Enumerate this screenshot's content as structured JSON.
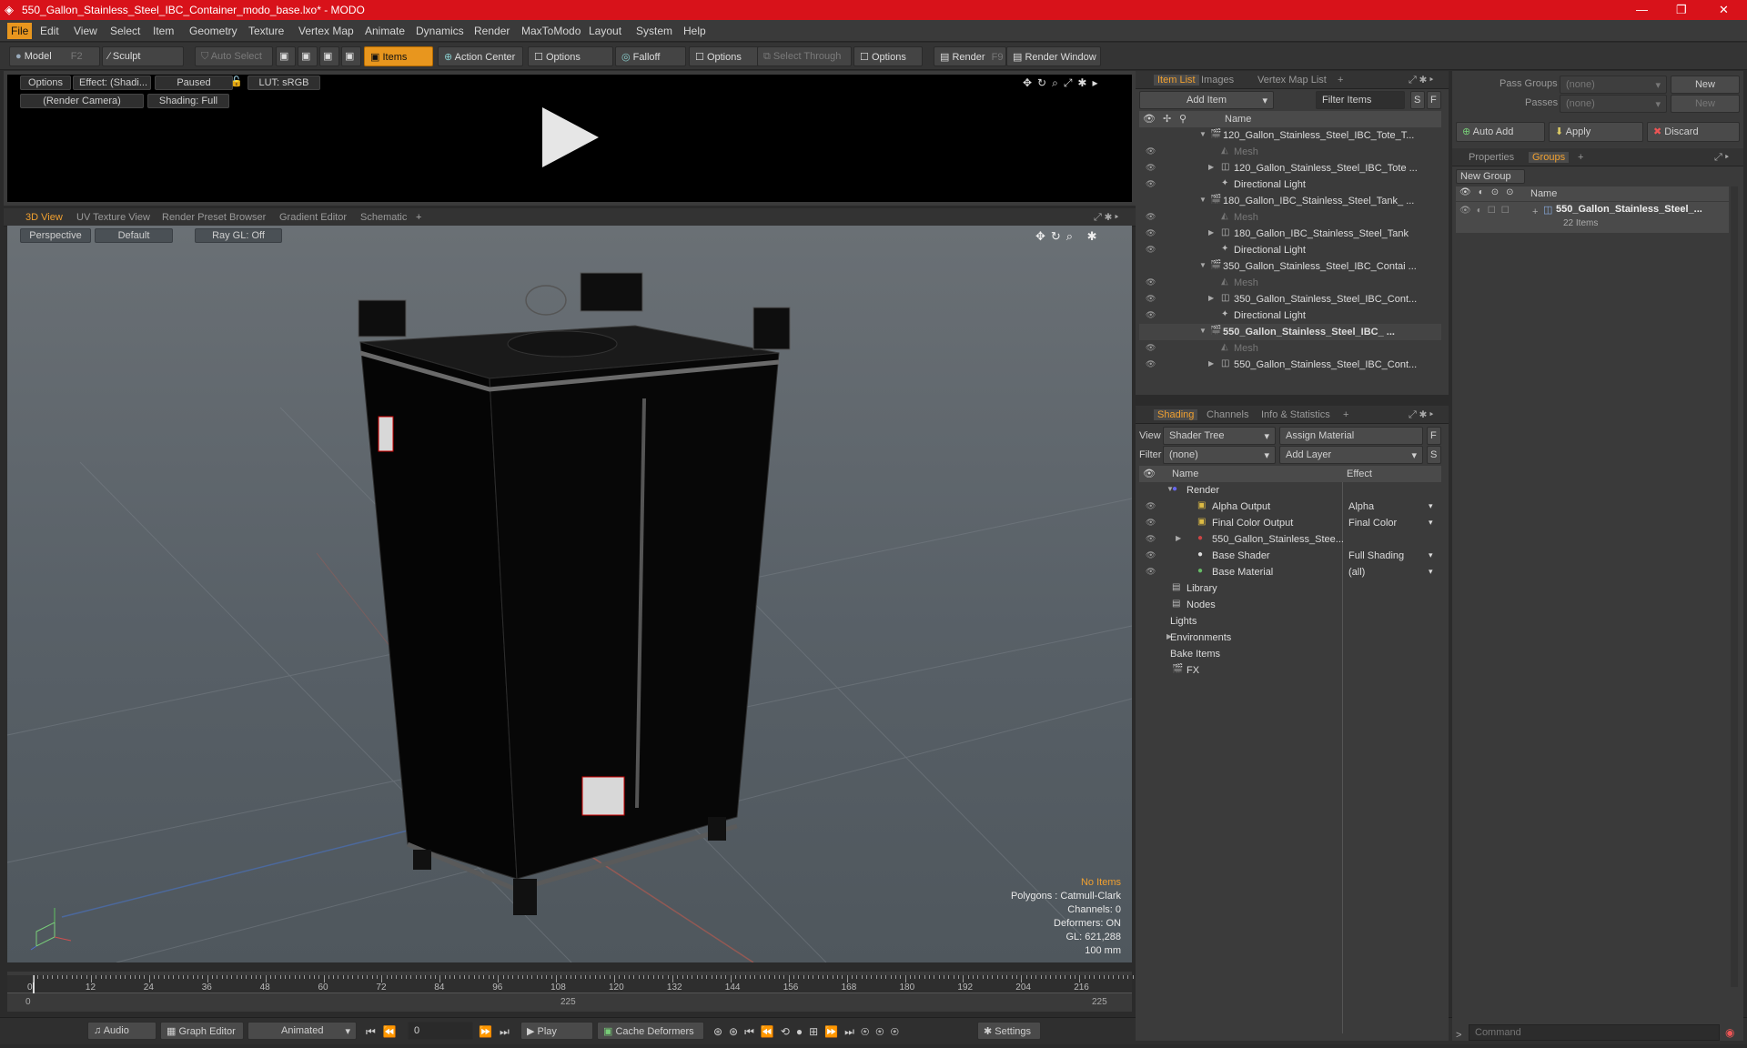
{
  "window": {
    "title": "550_Gallon_Stainless_Steel_IBC_Container_modo_base.lxo* - MODO"
  },
  "menu": [
    "File",
    "Edit",
    "View",
    "Select",
    "Item",
    "Geometry",
    "Texture",
    "Vertex Map",
    "Animate",
    "Dynamics",
    "Render",
    "MaxToModo",
    "Layout",
    "System",
    "Help"
  ],
  "toolbar": {
    "model": "Model",
    "model_key": "F2",
    "sculpt": "Sculpt",
    "auto_select": "Auto Select",
    "items": "Items",
    "action_center": "Action Center",
    "options1": "Options",
    "falloff": "Falloff",
    "options2": "Options",
    "select_through": "Select Through",
    "options3": "Options",
    "render": "Render",
    "render_key": "F9",
    "render_window": "Render Window"
  },
  "preview": {
    "options": "Options",
    "effect": "Effect: (Shadi...",
    "paused": "Paused",
    "lut": "LUT: sRGB",
    "camera": "(Render Camera)",
    "shading": "Shading: Full"
  },
  "viewtabs": [
    "3D View",
    "UV Texture View",
    "Render Preset Browser",
    "Gradient Editor",
    "Schematic"
  ],
  "viewport": {
    "perspective": "Perspective",
    "default": "Default",
    "raygl": "Ray GL: Off",
    "stats": {
      "no_items": "No Items",
      "polygons": "Polygons : Catmull-Clark",
      "channels": "Channels: 0",
      "deformers": "Deformers: ON",
      "gl": "GL: 621,288",
      "scale": "100 mm"
    }
  },
  "timeline": {
    "ticks": [
      "0",
      "12",
      "24",
      "36",
      "48",
      "60",
      "72",
      "84",
      "96",
      "108",
      "120",
      "132",
      "144",
      "156",
      "168",
      "180",
      "192",
      "204",
      "216"
    ],
    "start": "0",
    "mid": "225",
    "end": "225"
  },
  "transport": {
    "audio": "Audio",
    "graph_editor": "Graph Editor",
    "animated": "Animated",
    "frame": "0",
    "play": "Play",
    "cache": "Cache Deformers",
    "settings": "Settings"
  },
  "itemlist": {
    "tabs": [
      "Item List",
      "Images",
      "Vertex Map List"
    ],
    "add_item": "Add Item",
    "filter_items": "Filter Items",
    "s": "S",
    "f": "F",
    "col_name": "Name",
    "rows": [
      {
        "label": "120_Gallon_Stainless_Steel_IBC_Tote_T...",
        "indent": 1,
        "kind": "scene",
        "dim": false,
        "bold": false
      },
      {
        "label": "Mesh",
        "indent": 2,
        "kind": "mesh",
        "dim": true,
        "bold": false
      },
      {
        "label": "120_Gallon_Stainless_Steel_IBC_Tote ...",
        "indent": 2,
        "kind": "group",
        "dim": false,
        "bold": false
      },
      {
        "label": "Directional Light",
        "indent": 2,
        "kind": "light",
        "dim": false,
        "bold": false
      },
      {
        "label": "180_Gallon_IBC_Stainless_Steel_Tank_ ...",
        "indent": 1,
        "kind": "scene",
        "dim": false,
        "bold": false
      },
      {
        "label": "Mesh",
        "indent": 2,
        "kind": "mesh",
        "dim": true,
        "bold": false
      },
      {
        "label": "180_Gallon_IBC_Stainless_Steel_Tank",
        "indent": 2,
        "kind": "group",
        "dim": false,
        "bold": false
      },
      {
        "label": "Directional Light",
        "indent": 2,
        "kind": "light",
        "dim": false,
        "bold": false
      },
      {
        "label": "350_Gallon_Stainless_Steel_IBC_Contai ...",
        "indent": 1,
        "kind": "scene",
        "dim": false,
        "bold": false
      },
      {
        "label": "Mesh",
        "indent": 2,
        "kind": "mesh",
        "dim": true,
        "bold": false
      },
      {
        "label": "350_Gallon_Stainless_Steel_IBC_Cont...",
        "indent": 2,
        "kind": "group",
        "dim": false,
        "bold": false
      },
      {
        "label": "Directional Light",
        "indent": 2,
        "kind": "light",
        "dim": false,
        "bold": false
      },
      {
        "label": "550_Gallon_Stainless_Steel_IBC_ ...",
        "indent": 1,
        "kind": "scene",
        "dim": false,
        "bold": true
      },
      {
        "label": "Mesh",
        "indent": 2,
        "kind": "mesh",
        "dim": true,
        "bold": false
      },
      {
        "label": "550_Gallon_Stainless_Steel_IBC_Cont...",
        "indent": 2,
        "kind": "group",
        "dim": false,
        "bold": false
      }
    ]
  },
  "shading": {
    "tabs": [
      "Shading",
      "Channels",
      "Info & Statistics"
    ],
    "view_label": "View",
    "view_value": "Shader Tree",
    "assign_material": "Assign Material",
    "filter_label": "Filter",
    "filter_value": "(none)",
    "add_layer": "Add Layer",
    "f": "F",
    "s": "S",
    "col_name": "Name",
    "col_effect": "Effect",
    "rows": [
      {
        "label": "Render",
        "effect": "",
        "indent": 1,
        "eye": false
      },
      {
        "label": "Alpha Output",
        "effect": "Alpha",
        "indent": 2,
        "eye": true
      },
      {
        "label": "Final Color Output",
        "effect": "Final Color",
        "indent": 2,
        "eye": true
      },
      {
        "label": "550_Gallon_Stainless_Stee...",
        "effect": "",
        "indent": 2,
        "eye": true
      },
      {
        "label": "Base Shader",
        "effect": "Full Shading",
        "indent": 2,
        "eye": true
      },
      {
        "label": "Base Material",
        "effect": "(all)",
        "indent": 2,
        "eye": true
      },
      {
        "label": "Library",
        "effect": "",
        "indent": 1,
        "eye": false
      },
      {
        "label": "Nodes",
        "effect": "",
        "indent": 1,
        "eye": false
      },
      {
        "label": "Lights",
        "effect": "",
        "indent": 0,
        "eye": false
      },
      {
        "label": "Environments",
        "effect": "",
        "indent": 0,
        "eye": false
      },
      {
        "label": "Bake Items",
        "effect": "",
        "indent": 0,
        "eye": false
      },
      {
        "label": "FX",
        "effect": "",
        "indent": 1,
        "eye": false
      }
    ]
  },
  "groups": {
    "pass_groups_label": "Pass Groups",
    "pass_groups_value": "(none)",
    "new1": "New",
    "passes_label": "Passes",
    "passes_value": "(none)",
    "new2": "New",
    "auto_add": "Auto Add",
    "apply": "Apply",
    "discard": "Discard",
    "tabs": [
      "Properties",
      "Groups"
    ],
    "new_group": "New Group",
    "col_name": "Name",
    "item_name": "550_Gallon_Stainless_Steel_...",
    "item_count": "22 Items"
  },
  "command": {
    "placeholder": "Command"
  },
  "colors": {
    "titlebar": "#d8121a",
    "accent": "#e8961e"
  }
}
